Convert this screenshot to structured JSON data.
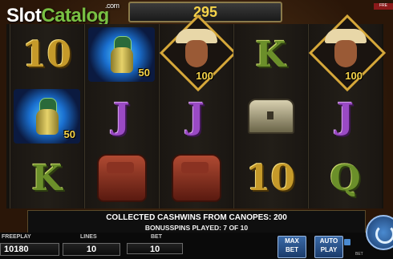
{
  "logo": {
    "slot": "Slot",
    "catalog": "Catalog",
    "dotcom": ".com"
  },
  "top_counter": "295",
  "free_label": "FRE",
  "reels": [
    [
      {
        "symbol": "10",
        "style": "letter-gold"
      },
      {
        "symbol": "canope",
        "value": "50"
      },
      {
        "symbol": "K",
        "style": "letter-green"
      }
    ],
    [
      {
        "symbol": "canope",
        "value": "50"
      },
      {
        "symbol": "J",
        "style": "letter-purple"
      },
      {
        "symbol": "bag"
      }
    ],
    [
      {
        "symbol": "explorer",
        "value": "100"
      },
      {
        "symbol": "J",
        "style": "letter-purple"
      },
      {
        "symbol": "bag"
      }
    ],
    [
      {
        "symbol": "K",
        "style": "letter-green"
      },
      {
        "symbol": "chest"
      },
      {
        "symbol": "10",
        "style": "letter-gold"
      }
    ],
    [
      {
        "symbol": "explorer",
        "value": "100"
      },
      {
        "symbol": "J",
        "style": "letter-purple"
      },
      {
        "symbol": "Q",
        "style": "letter-green"
      }
    ]
  ],
  "message": {
    "line1": "COLLECTED CASHWINS FROM CANOPES: 200",
    "line2": "BONUSSPINS PLAYED: 7 OF 10"
  },
  "bottom": {
    "freeplay_label": "FREEPLAY",
    "freeplay_value": "10180",
    "lines_label": "LINES",
    "lines_value": "10",
    "bet_label": "BET",
    "bet_value": "10",
    "max_bet_line1": "MAX",
    "max_bet_line2": "BET",
    "auto_play_line1": "AUTO",
    "auto_play_line2": "PLAY",
    "bet_small": "BET"
  },
  "colors": {
    "counter": "#f4d24a",
    "value": "#f5d34a",
    "accent_blue": "#3a6aa8"
  }
}
